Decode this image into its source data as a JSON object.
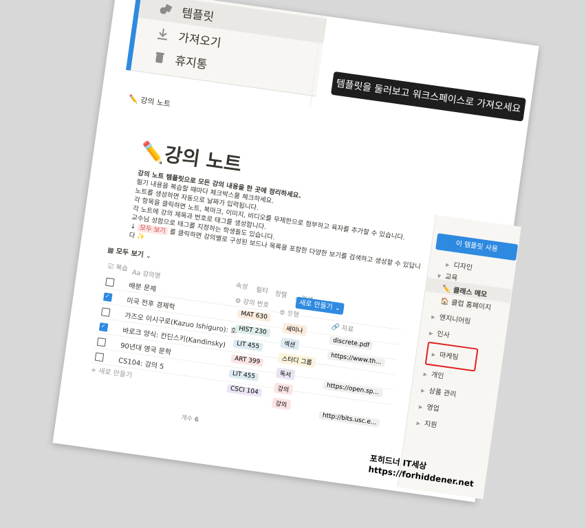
{
  "top_sidebar": {
    "items": [
      {
        "label": "템플릿",
        "icon": "shapes-icon"
      },
      {
        "label": "가져오기",
        "icon": "download-icon"
      },
      {
        "label": "휴지통",
        "icon": "trash-icon"
      }
    ],
    "accent": "#2e8ae0"
  },
  "tooltip": "템플릿을 둘러보고 워크스페이스로 가져오세요",
  "breadcrumb": "강의 노트",
  "page": {
    "title": "강의 노트",
    "desc_bold": "강의 노트 템플릿으로 모든 강의 내용을 한 곳에 정리하세요.",
    "desc_lines": [
      "필기 내용을 복습할 때마다 체크박스를 체크하세요.",
      "노트를 생성하면 자동으로 날짜가 입력됩니다.",
      "각 항목을 클릭하면 노트, 북마크, 이미지, 비디오를 무제한으로 첨부하고 육자를 추가할 수 있습니다.",
      "각 노트에 강의 제목과 번호로 태그를 생성합니다.",
      "교수님 성함으로 태그를 지정하는 학생들도 있습니다."
    ],
    "tag_text": "모두 보기",
    "desc_after_tag": "를 클릭하면 강의별로 구성된 보드나 목록을 포함한 다양한 보기를 검색하고 생성할 수 있답니다 ✨"
  },
  "db": {
    "view_label": "모두 보기",
    "filter_label": "속성",
    "filter2": "필터",
    "sort": "정렬",
    "search": "검색",
    "more": "...",
    "new_label": "새로 만들기",
    "columns": {
      "review": "복습",
      "name": "강의명",
      "number": "강의 번호",
      "type": "유형",
      "resource": "자료"
    },
    "rows": [
      {
        "checked": false,
        "name": "배분 문제",
        "number": "MAT 630",
        "type": "세미나",
        "resource": "discrete.pdf"
      },
      {
        "checked": true,
        "name": "미국 전후 경제학",
        "number": "HIST 230",
        "type": "섹션",
        "resource": "https://www.th..."
      },
      {
        "checked": false,
        "name": "가즈오 이시구로(Kazuo Ishiguro): 호",
        "number": "LIT 455",
        "type": "스터디 그룹",
        "resource": ""
      },
      {
        "checked": true,
        "name": "바로크 양식: 칸딘스키(Kandinsky)",
        "number": "ART 399",
        "type": "독서",
        "resource": "https://open.sp..."
      },
      {
        "checked": false,
        "name": "90년대 영국 문학",
        "number": "LIT 455",
        "type": "강의",
        "resource": ""
      },
      {
        "checked": false,
        "name": "CS104: 강의 5",
        "number": "CSCI 104",
        "type": "강의",
        "resource": "http://bits.usc.e..."
      }
    ],
    "add_row": "+ 새로 만들기",
    "count_label": "개수",
    "count_value": "6"
  },
  "right_sidebar": {
    "use_button": "이 템플릿 사용",
    "items": [
      {
        "label": "디자인",
        "indent": 1
      },
      {
        "label": "교육",
        "indent": 0
      },
      {
        "label": "클래스 메모",
        "indent": 1,
        "active": true
      },
      {
        "label": "클럽 홈페이지",
        "indent": 1
      },
      {
        "label": "엔지니어링",
        "indent": 0
      },
      {
        "label": "인사",
        "indent": 0
      },
      {
        "label": "마케팅",
        "indent": 0,
        "highlighted": true
      },
      {
        "label": "개인",
        "indent": 0
      },
      {
        "label": "상품 관리",
        "indent": 0
      },
      {
        "label": "영업",
        "indent": 0
      },
      {
        "label": "지원",
        "indent": 0
      }
    ]
  },
  "watermark": {
    "line1": "포히드너 IT세상",
    "line2": "https://forhiddener.net"
  }
}
